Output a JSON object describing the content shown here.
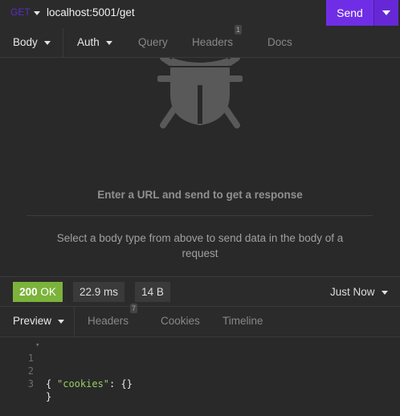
{
  "request": {
    "method": "GET",
    "url": "localhost:5001/get",
    "send_label": "Send"
  },
  "request_tabs": [
    {
      "label": "Body",
      "active": true,
      "dropdown": true
    },
    {
      "label": "Auth",
      "active": false,
      "dropdown": true
    },
    {
      "label": "Query",
      "active": false
    },
    {
      "label": "Headers",
      "active": false,
      "count": "1"
    },
    {
      "label": "Docs",
      "active": false
    }
  ],
  "empty_state": {
    "icon": "bug-icon",
    "title": "Enter a URL and send to get a response",
    "description": "Select a body type from above to send data in the body of a request"
  },
  "response": {
    "status_code": "200",
    "status_text": "OK",
    "time": "22.9 ms",
    "size": "14 B",
    "history_label": "Just Now"
  },
  "response_tabs": [
    {
      "label": "Preview",
      "active": true,
      "dropdown": true
    },
    {
      "label": "Headers",
      "active": false,
      "count": "7"
    },
    {
      "label": "Cookies",
      "active": false
    },
    {
      "label": "Timeline",
      "active": false
    }
  ],
  "code": {
    "line_numbers": [
      "1",
      "2",
      "3"
    ],
    "open_brace": "{",
    "key": "\"cookies\"",
    "separator": ": ",
    "value": "{}",
    "close_brace": "}"
  },
  "colors": {
    "accent": "#6f2ee6",
    "status_ok": "#7bb33b",
    "json_key": "#9ccc65"
  }
}
